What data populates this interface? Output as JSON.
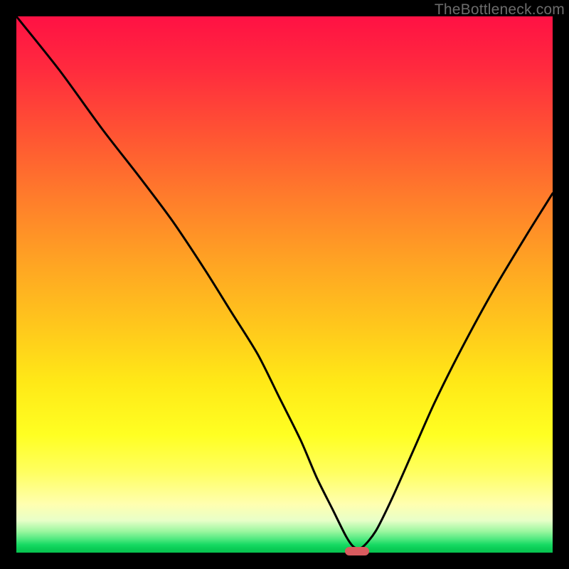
{
  "watermark": "TheBottleneck.com",
  "chart_data": {
    "type": "line",
    "title": "",
    "xlabel": "",
    "ylabel": "",
    "xlim": [
      0,
      100
    ],
    "ylim": [
      0,
      100
    ],
    "grid": false,
    "legend": false,
    "annotations": [],
    "series": [
      {
        "name": "bottleneck-curve",
        "x": [
          0,
          8,
          16,
          23,
          29,
          35,
          40,
          45,
          49,
          53,
          56,
          59,
          61.5,
          63,
          64.5,
          67,
          70,
          74,
          78,
          83,
          89,
          95,
          100
        ],
        "values": [
          100,
          90,
          79,
          70,
          62,
          53,
          45,
          37,
          29,
          21,
          14,
          8,
          3,
          1,
          1,
          4,
          10,
          19,
          28,
          38,
          49,
          59,
          67
        ]
      }
    ],
    "marker": {
      "name": "optimal-range-marker",
      "x_center": 63.5,
      "width_pct": 4.5,
      "color": "#d95b5f"
    },
    "gradient_stops": [
      {
        "pos": 0,
        "color": "#ff1144"
      },
      {
        "pos": 0.78,
        "color": "#ffff22"
      },
      {
        "pos": 1.0,
        "color": "#08c24f"
      }
    ]
  }
}
